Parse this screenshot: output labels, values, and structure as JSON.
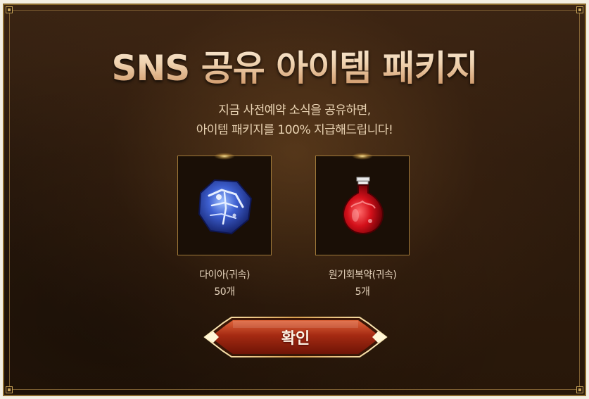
{
  "popup": {
    "title": "SNS 공유 아이템 패키지",
    "subtitle_line1": "지금 사전예약 소식을 공유하면,",
    "subtitle_line2": "아이템 패키지를 100% 지급해드립니다!"
  },
  "items": [
    {
      "name": "다이아(귀속)",
      "count": "50개",
      "icon": "blue-diamond-icon"
    },
    {
      "name": "원기회복약(귀속)",
      "count": "5개",
      "icon": "red-potion-icon"
    }
  ],
  "confirm": {
    "label": "확인"
  },
  "colors": {
    "frame_gold": "#8a6a2e",
    "background_brown": "#2e1c0e",
    "button_red": "#9c2a14",
    "text_cream": "#e9d3b3"
  }
}
